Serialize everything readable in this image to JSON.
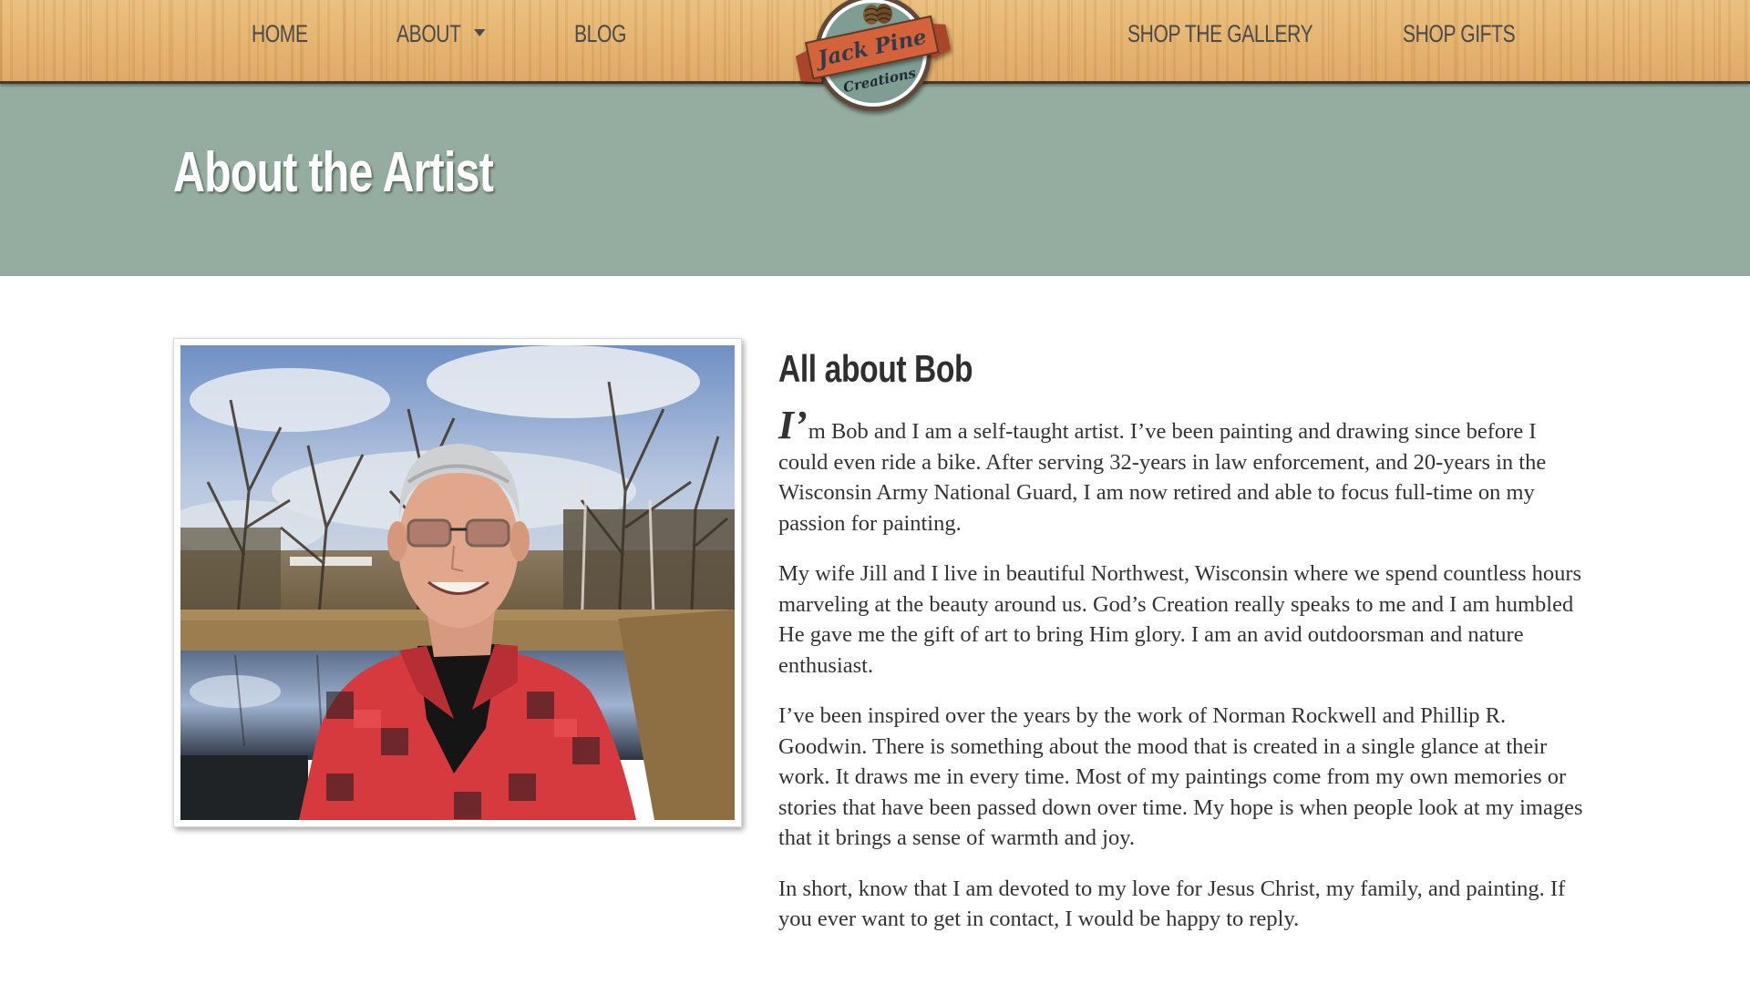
{
  "nav": {
    "items": [
      {
        "label": "HOME"
      },
      {
        "label": "ABOUT"
      },
      {
        "label": "BLOG"
      },
      {
        "label": "SHOP THE GALLERY"
      },
      {
        "label": "SHOP GIFTS"
      }
    ],
    "logo": {
      "line1": "Jack Pine",
      "line2": "Creations",
      "icon": "pinecone-icon"
    }
  },
  "hero": {
    "title": "About the Artist"
  },
  "main": {
    "photo_alt": "Bob in a red plaid shirt by a creek",
    "heading": "All about Bob",
    "dropcap": "I’",
    "paragraphs": [
      "m Bob and I am a self-taught artist. I’ve been painting and drawing since before I could even ride a bike. After serving 32-years in law enforcement, and 20-years in the Wisconsin Army National Guard, I am now retired and able to focus full-time on my passion for painting.",
      "My wife Jill and I live in beautiful Northwest, Wisconsin where we spend countless hours marveling at the beauty around us. God’s Creation really speaks to me and I am humbled He gave me the gift of art to bring Him glory. I am an avid outdoorsman and nature enthusiast.",
      "I’ve been inspired over the years by the work of Norman Rockwell and Phillip R. Goodwin. There is something about the mood that is created in a single glance at their work. It draws me in every time. Most of my paintings come from my own memories or stories that have been passed down over time. My hope is when people look at my images that it brings a sense of warmth and joy.",
      "In short, know that I am devoted to my love for Jesus Christ, my family, and painting. If you ever want to get in contact, I would be happy to reply."
    ]
  },
  "colors": {
    "hero_band": "#95ada0",
    "logo_ribbon": "#d4643a",
    "logo_circle": "#7f9d92",
    "nav_text": "#4a4a4a"
  }
}
